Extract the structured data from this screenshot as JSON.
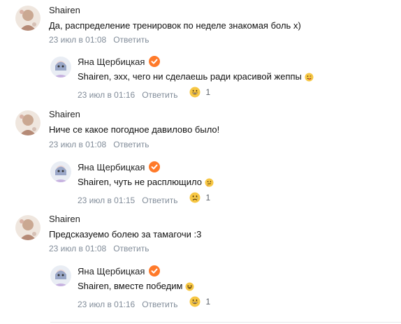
{
  "threads": [
    {
      "comment": {
        "author": "Shairen",
        "text": "Да, распределение тренировок по неделе знакомая боль х)",
        "date": "23 июл в 01:08",
        "reply_label": "Ответить"
      },
      "reply": {
        "author": "Яна Щербицкая",
        "text": "Shairen, эхх, чего ни сделаешь ради красивой жеппы",
        "emoji": "winking-tongue-face",
        "date": "23 июл в 01:16",
        "reply_label": "Ответить",
        "like_emoji": "grinning-face",
        "likes": "1"
      }
    },
    {
      "comment": {
        "author": "Shairen",
        "text": "Ниче се какое погодное давиловo было!",
        "date": "23 июл в 01:08",
        "reply_label": "Ответить"
      },
      "reply": {
        "author": "Яна Щербицкая",
        "text": "Shairen, чуть не расплющило",
        "emoji": "thinking-face",
        "date": "23 июл в 01:15",
        "reply_label": "Ответить",
        "like_emoji": "sad-face",
        "likes": "1"
      }
    },
    {
      "comment": {
        "author": "Shairen",
        "text": "Предсказуемо болею за тамагочи :3",
        "date": "23 июл в 01:08",
        "reply_label": "Ответить"
      },
      "reply": {
        "author": "Яна Щербицкая",
        "text": "Shairen, вместе победим",
        "emoji": "grinning-squinting-face",
        "date": "23 июл в 01:16",
        "reply_label": "Ответить",
        "like_emoji": "grinning-face",
        "likes": "1"
      }
    }
  ],
  "colors": {
    "accent_verified": "#ff7a2a",
    "meta": "#818c99",
    "emoji": "#f7c744"
  }
}
